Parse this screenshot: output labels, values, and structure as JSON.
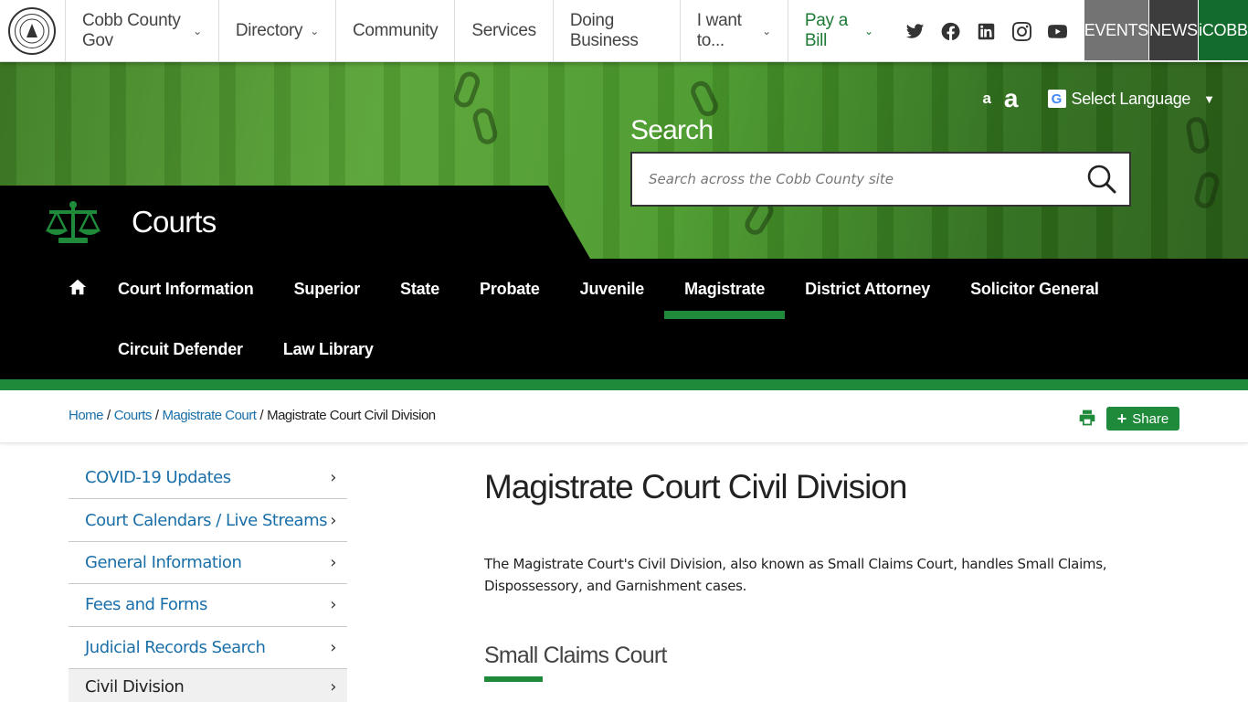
{
  "top_nav": {
    "seal_text": "COBB COUNTY STATE OF GEORGIA",
    "items": [
      {
        "label": "Cobb County Gov",
        "has_dropdown": true
      },
      {
        "label": "Directory",
        "has_dropdown": true
      },
      {
        "label": "Community",
        "has_dropdown": false
      },
      {
        "label": "Services",
        "has_dropdown": false
      },
      {
        "label": "Doing Business",
        "has_dropdown": false
      },
      {
        "label": "I want to...",
        "has_dropdown": true
      },
      {
        "label": "Pay a Bill",
        "has_dropdown": true
      }
    ],
    "social_icons": [
      "twitter-icon",
      "facebook-icon",
      "linkedin-icon",
      "instagram-icon",
      "youtube-icon"
    ],
    "events_label": "EVENTS",
    "news_label": "NEWS",
    "icobb_label": "iCOBB"
  },
  "hero": {
    "font_small_label": "a",
    "font_large_label": "a",
    "language_label": "Select Language",
    "search_label": "Search",
    "search_placeholder": "Search across the Cobb County site",
    "department_title": "Courts"
  },
  "dept_nav": {
    "row1": [
      "Court Information",
      "Superior",
      "State",
      "Probate",
      "Juvenile",
      "Magistrate",
      "District Attorney",
      "Solicitor General"
    ],
    "row2": [
      "Circuit Defender",
      "Law Library"
    ],
    "active": "Magistrate"
  },
  "breadcrumb": {
    "items": [
      "Home",
      "Courts",
      "Magistrate Court"
    ],
    "current": "Magistrate Court Civil Division",
    "share_label": "Share"
  },
  "sidebar": {
    "items": [
      "COVID-19 Updates",
      "Court Calendars / Live Streams",
      "General Information",
      "Fees and Forms",
      "Judicial Records Search",
      "Civil Division"
    ],
    "current": "Civil Division"
  },
  "main": {
    "title": "Magistrate Court Civil Division",
    "paragraph": "The Magistrate Court's Civil Division, also known as Small Claims Court, handles Small Claims, Dispossessory, and Garnishment cases.",
    "subheading": "Small Claims Court"
  },
  "colors": {
    "brand_green": "#1e8a3a",
    "link_blue": "#1a6fa8",
    "events_bg": "#737373",
    "news_bg": "#3d3d3d",
    "icobb_bg": "#146b2e"
  }
}
